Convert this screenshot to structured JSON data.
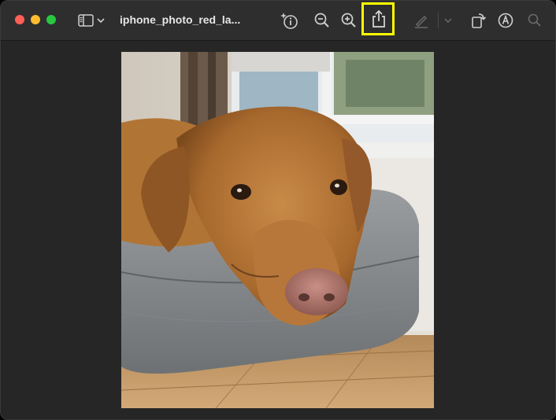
{
  "window": {
    "title": "iphone_photo_red_la..."
  },
  "toolbar": {
    "sidebar_icon": "sidebar-toggle-icon",
    "chevron_icon": "chevron-down-icon",
    "info_icon": "info-sparkle-icon",
    "zoom_out_icon": "zoom-out-icon",
    "zoom_in_icon": "zoom-in-icon",
    "share_icon": "share-icon",
    "markup_pen_icon": "pen-icon",
    "rotate_icon": "rotate-icon",
    "markup_icon": "markup-icon",
    "search_icon": "search-icon"
  },
  "colors": {
    "highlight": "#ffff00",
    "close": "#ff5f57",
    "minimize": "#febc2e",
    "maximize": "#28c840"
  },
  "image": {
    "subject": "dog-on-bed-photo"
  }
}
